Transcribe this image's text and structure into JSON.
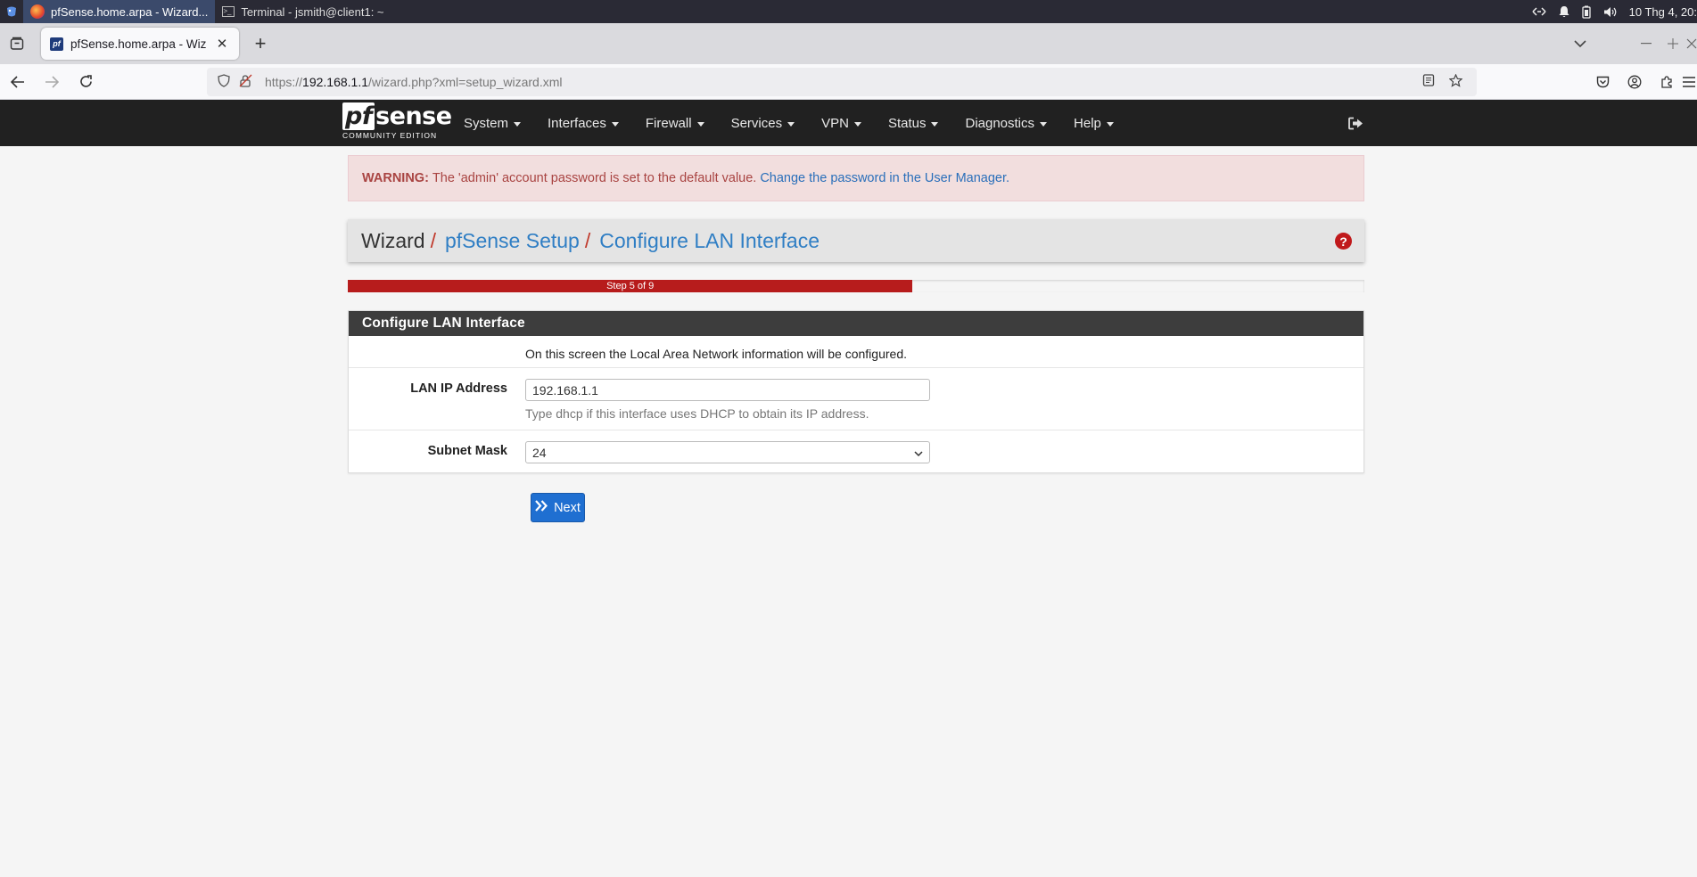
{
  "taskbar": {
    "tasks": [
      {
        "label": "pfSense.home.arpa - Wizard..."
      },
      {
        "label": "Terminal - jsmith@client1: ~"
      }
    ],
    "clock": "10 Thg 4, 20:"
  },
  "browser": {
    "tab_title": "pfSense.home.arpa - Wizard:",
    "tab_favicon_text": "pf",
    "url_prefix": "https://",
    "url_host": "192.168.1.1",
    "url_path": "/wizard.php?xml=setup_wizard.xml"
  },
  "pfsense": {
    "logo_main": "sense",
    "logo_box": "pf",
    "logo_sub": "COMMUNITY EDITION",
    "menu": [
      {
        "label": "System"
      },
      {
        "label": "Interfaces"
      },
      {
        "label": "Firewall"
      },
      {
        "label": "Services"
      },
      {
        "label": "VPN"
      },
      {
        "label": "Status"
      },
      {
        "label": "Diagnostics"
      },
      {
        "label": "Help"
      }
    ]
  },
  "alert": {
    "strong": "WARNING:",
    "text": "The 'admin' account password is set to the default value.",
    "link": "Change the password in the User Manager."
  },
  "breadcrumb": {
    "root": "Wizard",
    "sep": "/",
    "level1": "pfSense Setup",
    "level2": "Configure LAN Interface"
  },
  "progress": {
    "label": "Step 5 of 9",
    "fraction": 0.5556
  },
  "panel": {
    "title": "Configure LAN Interface",
    "intro": "On this screen the Local Area Network information will be configured.",
    "lan_ip": {
      "label": "LAN IP Address",
      "value": "192.168.1.1",
      "help": "Type dhcp if this interface uses DHCP to obtain its IP address."
    },
    "subnet": {
      "label": "Subnet Mask",
      "value": "24"
    }
  },
  "next_button": {
    "label": "Next"
  },
  "colors": {
    "pf_navbar": "#212121",
    "progress": "#b71c1c",
    "link": "#2f7ec4",
    "button": "#1f6fd1"
  }
}
